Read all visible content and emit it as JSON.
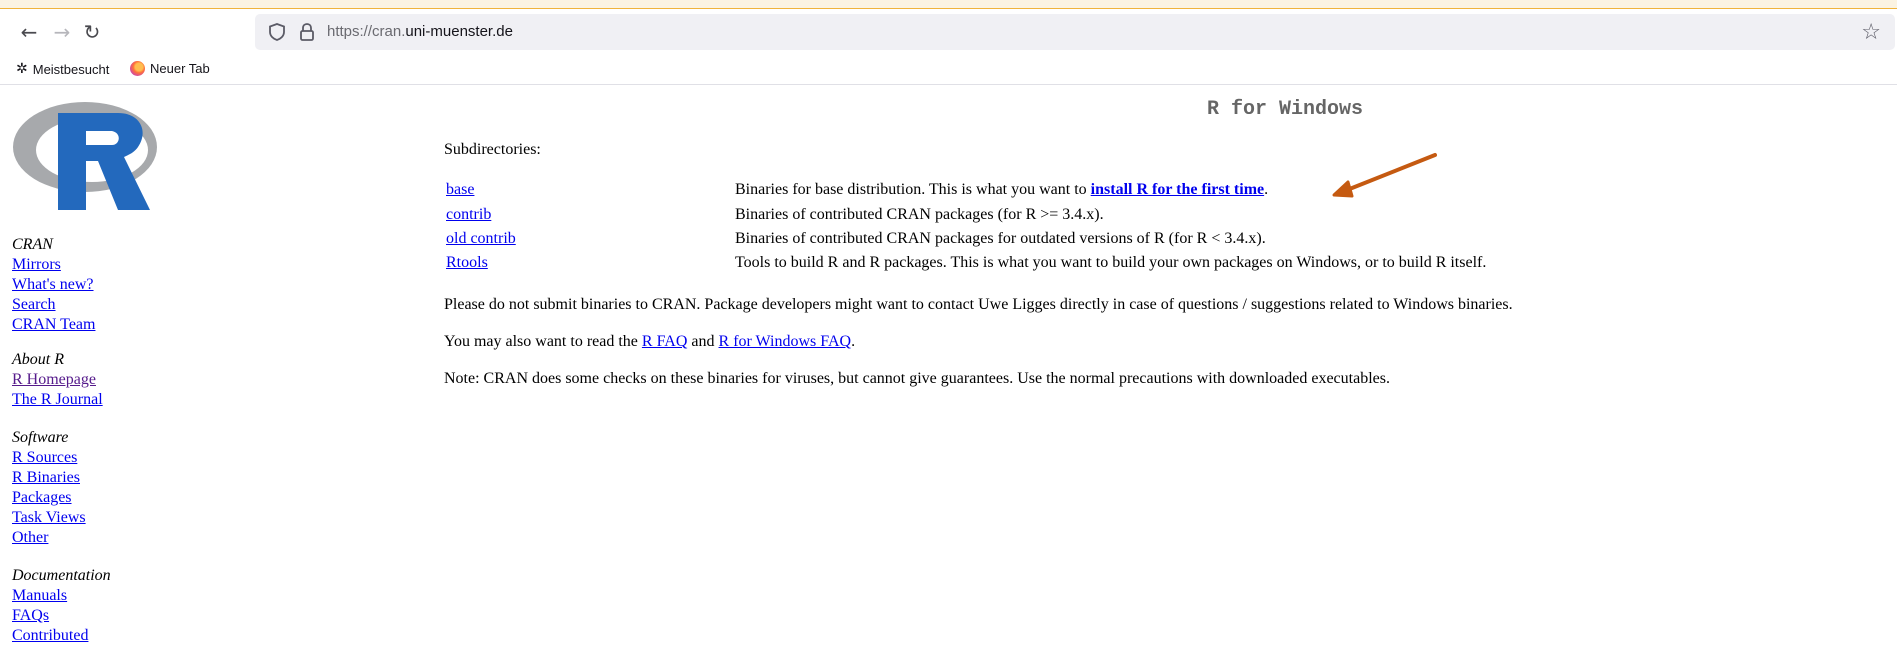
{
  "browser": {
    "url_prefix": "https://cran.",
    "url_domain": "uni-muenster.de",
    "bookmarks": [
      {
        "label": "Meistbesucht"
      },
      {
        "label": "Neuer Tab"
      }
    ]
  },
  "sidebar": {
    "groups": [
      {
        "heading": "CRAN",
        "links": [
          "Mirrors",
          "What's new?",
          "Search",
          "CRAN Team"
        ]
      },
      {
        "heading": "About R",
        "links": [
          "R Homepage",
          "The R Journal"
        ]
      },
      {
        "heading": "Software",
        "links": [
          "R Sources",
          "R Binaries",
          "Packages",
          "Task Views",
          "Other"
        ]
      },
      {
        "heading": "Documentation",
        "links": [
          "Manuals",
          "FAQs",
          "Contributed"
        ]
      }
    ]
  },
  "main": {
    "title": "R for Windows",
    "subdirectories_label": "Subdirectories:",
    "subdirs": [
      {
        "name": "base",
        "desc": "Binaries for base distribution. This is what you want to ",
        "desc_link": "install R for the first time",
        "desc_after": "."
      },
      {
        "name": "contrib",
        "desc": "Binaries of contributed CRAN packages (for R >= 3.4.x)."
      },
      {
        "name": "old contrib",
        "desc": "Binaries of contributed CRAN packages for outdated versions of R (for R < 3.4.x)."
      },
      {
        "name": "Rtools",
        "desc": "Tools to build R and R packages. This is what you want to build your own packages on Windows, or to build R itself."
      }
    ],
    "para1": "Please do not submit binaries to CRAN. Package developers might want to contact Uwe Ligges directly in case of questions / suggestions related to Windows binaries.",
    "para2_before": "You may also want to read the ",
    "para2_link1": "R FAQ",
    "para2_mid": " and ",
    "para2_link2": "R for Windows FAQ",
    "para2_after": ".",
    "para3": "Note: CRAN does some checks on these binaries for viruses, but cannot give guarantees. Use the normal precautions with downloaded executables."
  },
  "colors": {
    "link": "#0000ee",
    "visited": "#551a8b",
    "arrow": "#c55a11"
  }
}
